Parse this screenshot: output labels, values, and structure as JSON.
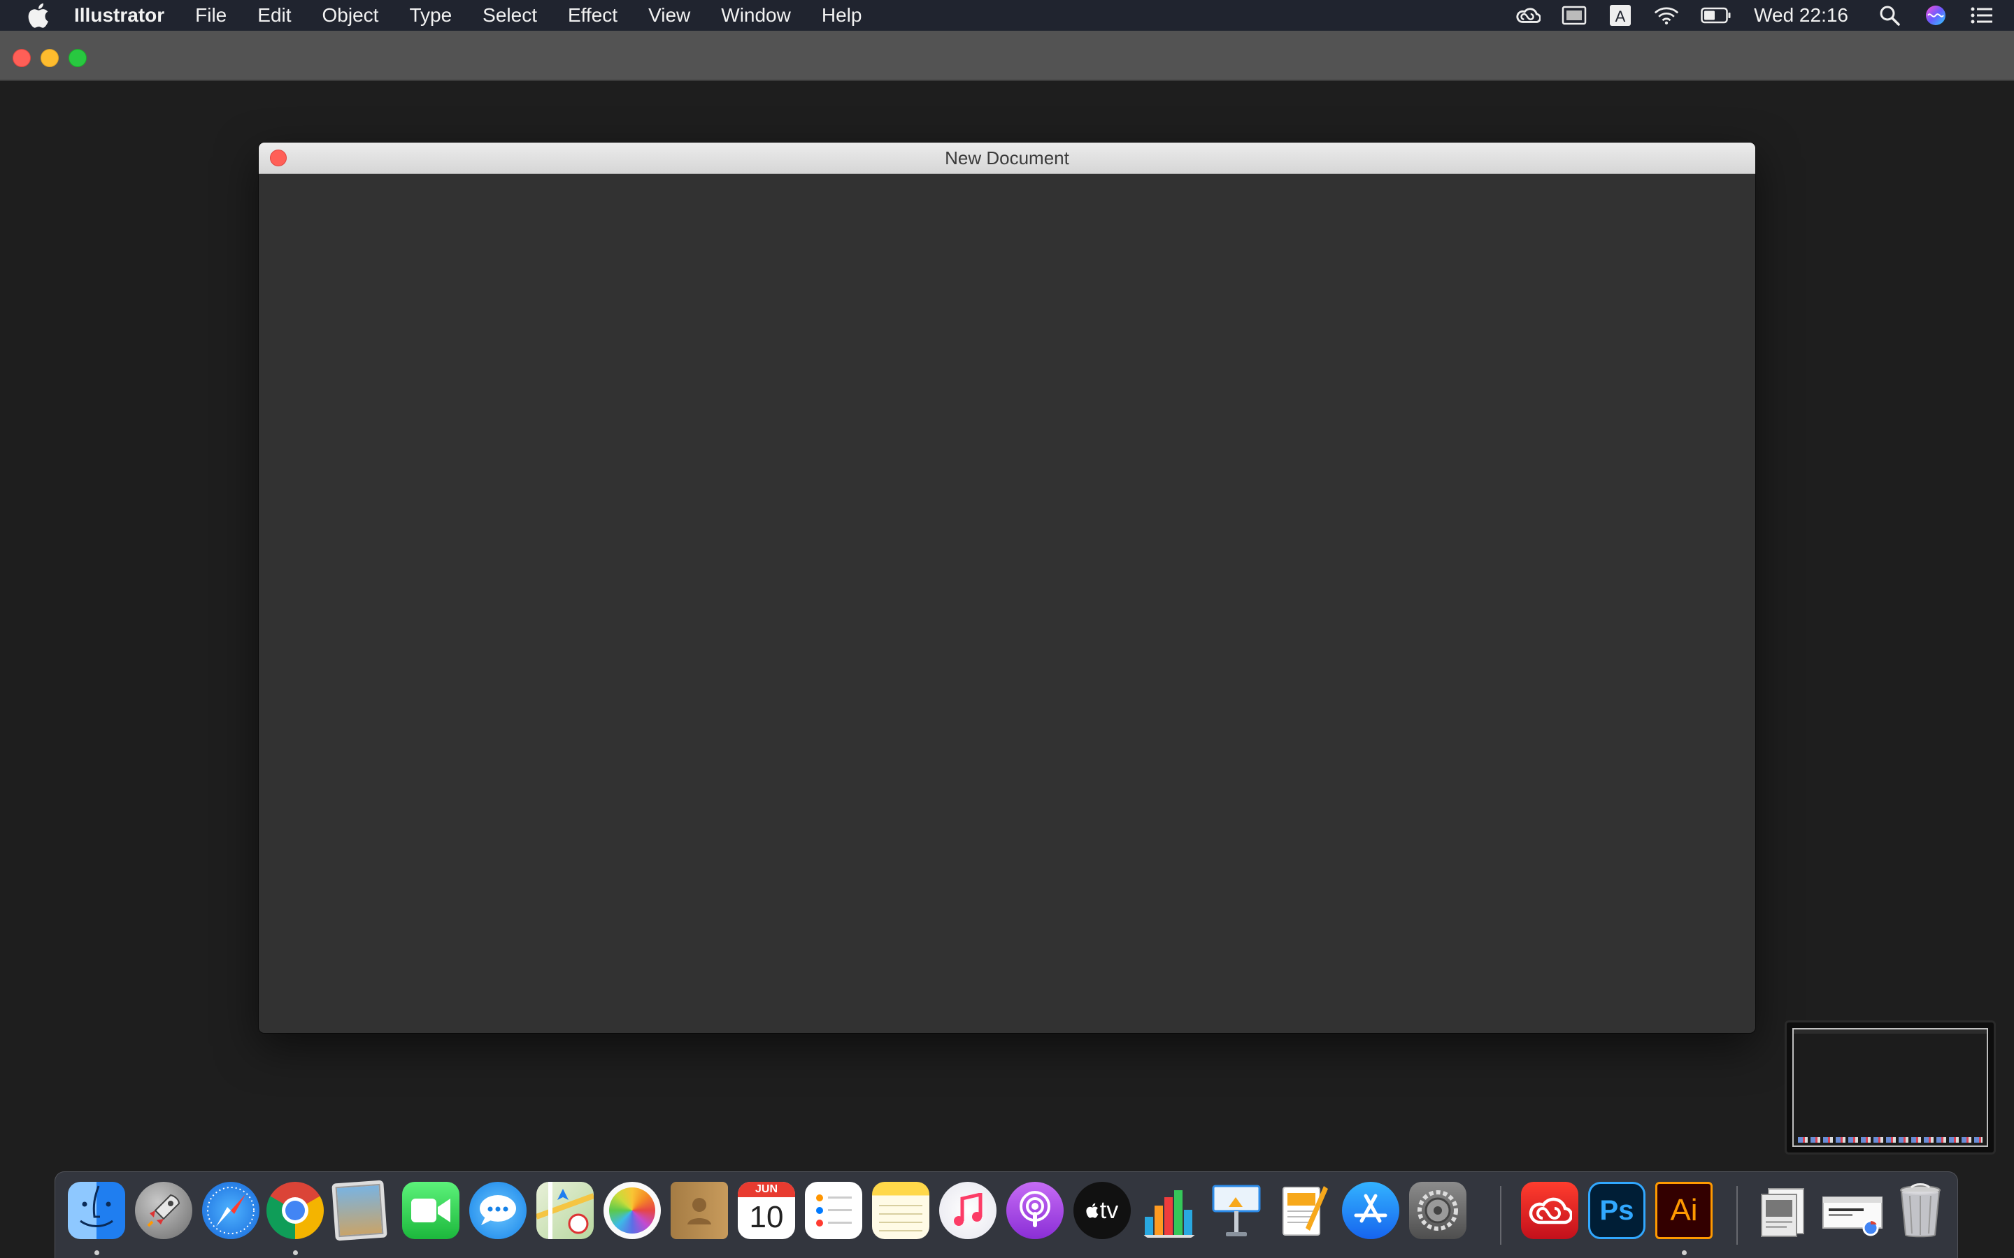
{
  "menubar": {
    "apple_icon": "apple-logo-icon",
    "app_name": "Illustrator",
    "items": [
      "File",
      "Edit",
      "Object",
      "Type",
      "Select",
      "Effect",
      "View",
      "Window",
      "Help"
    ],
    "status_icons": [
      "creative-cloud-icon",
      "display-icon",
      "input-source-icon",
      "wifi-icon",
      "battery-icon"
    ],
    "input_source_letter": "A",
    "clock": "Wed 22:16",
    "spotlight_icon": "search-icon",
    "siri_icon": "siri-icon",
    "control_icon": "notification-center-icon"
  },
  "dialog": {
    "title": "New Document"
  },
  "dock": {
    "apps": [
      {
        "name": "Finder",
        "icon": "finder-icon",
        "running": true
      },
      {
        "name": "Launchpad",
        "icon": "launchpad-icon",
        "running": false
      },
      {
        "name": "Safari",
        "icon": "safari-icon",
        "running": false
      },
      {
        "name": "Google Chrome",
        "icon": "chrome-icon",
        "running": true
      },
      {
        "name": "Preview",
        "icon": "preview-icon",
        "running": false
      },
      {
        "name": "FaceTime",
        "icon": "facetime-icon",
        "running": false
      },
      {
        "name": "Messages",
        "icon": "messages-icon",
        "running": false
      },
      {
        "name": "Maps",
        "icon": "maps-icon",
        "running": false
      },
      {
        "name": "Photos",
        "icon": "photos-icon",
        "running": false
      },
      {
        "name": "Contacts",
        "icon": "contacts-icon",
        "running": false
      },
      {
        "name": "Calendar",
        "icon": "calendar-icon",
        "running": false
      },
      {
        "name": "Reminders",
        "icon": "reminders-icon",
        "running": false
      },
      {
        "name": "Notes",
        "icon": "notes-icon",
        "running": false
      },
      {
        "name": "Music",
        "icon": "music-icon",
        "running": false
      },
      {
        "name": "Podcasts",
        "icon": "podcasts-icon",
        "running": false
      },
      {
        "name": "TV",
        "icon": "tv-icon",
        "running": false
      },
      {
        "name": "Numbers",
        "icon": "numbers-icon",
        "running": false
      },
      {
        "name": "Keynote",
        "icon": "keynote-icon",
        "running": false
      },
      {
        "name": "Pages",
        "icon": "pages-icon",
        "running": false
      },
      {
        "name": "App Store",
        "icon": "app-store-icon",
        "running": false
      },
      {
        "name": "System Preferences",
        "icon": "system-preferences-icon",
        "running": false
      },
      {
        "name": "Creative Cloud",
        "icon": "creative-cloud-icon",
        "running": false
      },
      {
        "name": "Photoshop",
        "icon": "photoshop-icon",
        "running": false
      },
      {
        "name": "Illustrator",
        "icon": "illustrator-icon",
        "running": true
      }
    ],
    "calendar_month": "JUN",
    "calendar_day": "10",
    "tv_label": "tv",
    "photoshop_label": "Ps",
    "illustrator_label": "Ai",
    "documents": [
      {
        "icon": "document-stack-icon"
      },
      {
        "icon": "chrome-window-icon"
      },
      {
        "icon": "trash-icon"
      }
    ]
  },
  "colors": {
    "menubar_bg": "#20242f",
    "desktop_bg": "#1c1c1c",
    "dialog_bg": "#323232",
    "illustrator_orange": "#ff9a00",
    "photoshop_blue": "#31a8ff"
  }
}
